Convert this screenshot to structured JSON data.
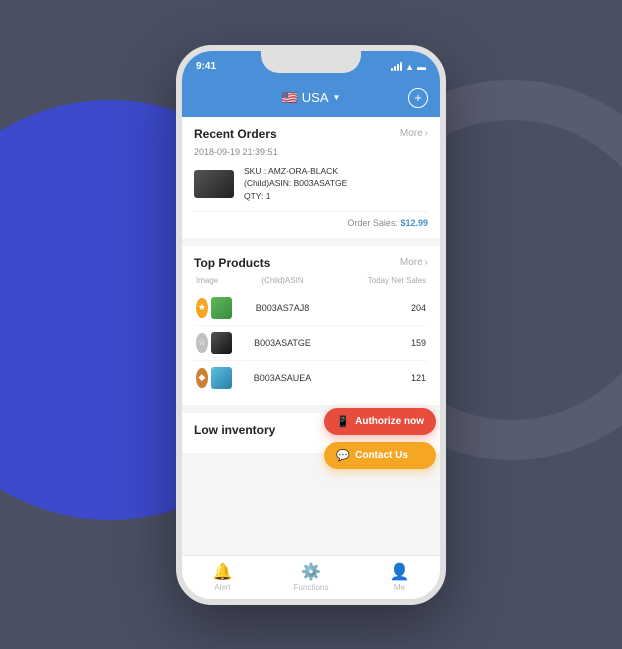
{
  "background": {
    "accent_color": "#4a4f63",
    "circle_color": "#3d4acc"
  },
  "phone": {
    "status_bar": {
      "time": "9:41"
    },
    "header": {
      "country": "USA",
      "flag": "🇺🇸",
      "chevron": "▼"
    },
    "sections": {
      "recent_orders": {
        "title": "Recent Orders",
        "more_label": "More",
        "timestamp": "2018-09-19 21:39:51",
        "item": {
          "sku": "SKU : AMZ-ORA-BLACK",
          "child_asin": "(Child)ASIN: B003ASATGE",
          "qty": "QTY: 1",
          "order_sales_label": "Order Sales:",
          "order_price": "$12.99"
        }
      },
      "top_products": {
        "title": "Top Products",
        "more_label": "More",
        "columns": [
          "Image",
          "(Child)ASIN",
          "Today Net Sales"
        ],
        "items": [
          {
            "rank": 1,
            "asin": "B003AS7AJ8",
            "sales": "204",
            "image_type": "green"
          },
          {
            "rank": 2,
            "asin": "B003ASATGE",
            "sales": "159",
            "image_type": "black"
          },
          {
            "rank": 3,
            "asin": "B003ASAUEA",
            "sales": "121",
            "image_type": "blue"
          }
        ]
      },
      "low_inventory": {
        "title": "Low inventory"
      }
    },
    "floating_buttons": {
      "authorize": "Authorize now",
      "contact": "Contact Us"
    },
    "bottom_nav": [
      {
        "label": "Alert",
        "icon": "🔔"
      },
      {
        "label": "Functions",
        "icon": "⚙️"
      },
      {
        "label": "Me",
        "icon": "👤"
      }
    ]
  }
}
